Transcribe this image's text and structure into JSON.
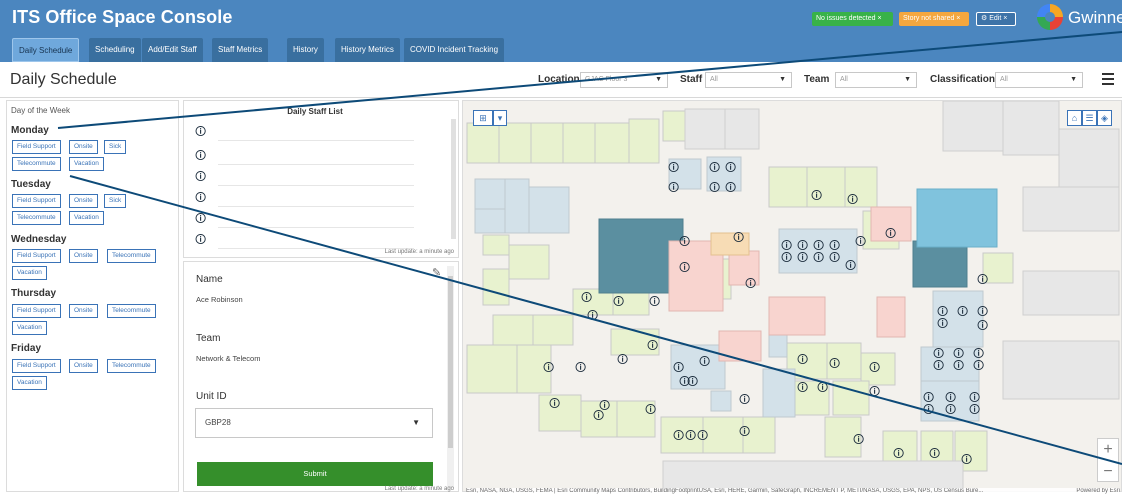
{
  "header": {
    "title": "ITS Office Space Console",
    "badges": {
      "issues": "No issues detected ×",
      "story": "Story not shared ×",
      "edit": "⚙ Edit ×"
    },
    "brand": "Gwinnett",
    "colors": {
      "primary": "#4b86bf",
      "accent_green": "#38b249",
      "accent_orange": "#f4a73f",
      "submit": "#358f2b"
    }
  },
  "tabs": [
    {
      "label": "Daily Schedule",
      "active": true
    },
    {
      "label": "Scheduling"
    },
    {
      "label": "Add/Edit Staff"
    },
    {
      "label": "Staff Metrics"
    },
    {
      "label": "History"
    },
    {
      "label": "History Metrics"
    },
    {
      "label": "COVID Incident Tracking"
    }
  ],
  "subheader": {
    "title": "Daily Schedule",
    "filters": {
      "location_label": "Location",
      "location_value": "GJAC Floor 3",
      "staff_label": "Staff",
      "staff_value": "All",
      "team_label": "Team",
      "team_value": "All",
      "classification_label": "Classification",
      "classification_value": "All"
    }
  },
  "days_panel": {
    "label": "Day of the Week",
    "days": [
      {
        "name": "Monday",
        "chips": [
          "Field Support",
          "Onsite",
          "Sick",
          "Telecommute",
          "Vacation"
        ]
      },
      {
        "name": "Tuesday",
        "chips": [
          "Field Support",
          "Onsite",
          "Sick",
          "Telecommute",
          "Vacation"
        ]
      },
      {
        "name": "Wednesday",
        "chips": [
          "Field Support",
          "Onsite",
          "Telecommute",
          "Vacation"
        ]
      },
      {
        "name": "Thursday",
        "chips": [
          "Field Support",
          "Onsite",
          "Telecommute",
          "Vacation"
        ]
      },
      {
        "name": "Friday",
        "chips": [
          "Field Support",
          "Onsite",
          "Telecommute",
          "Vacation"
        ]
      }
    ]
  },
  "staff_list": {
    "title": "Daily Staff List",
    "footer": "Last update: a minute ago"
  },
  "detail": {
    "name_label": "Name",
    "name_value": "Ace Robinson",
    "team_label": "Team",
    "team_value": "Network & Telecom",
    "unit_label": "Unit ID",
    "unit_value": "GBP28",
    "submit_label": "Submit",
    "footer": "Last update: a minute ago"
  },
  "map": {
    "attribution": "Esri, NASA, NGA, USGS, FEMA | Esri Community Maps Contributors, BuildingFootprintUSA, Esri, HERE, Garmin, SafeGraph, INCREMENT P, METI/NASA, USGS, EPA, NPS, US Census Bure...",
    "powered_by": "Powered by Esri",
    "zoom_in": "+",
    "zoom_out": "−"
  }
}
